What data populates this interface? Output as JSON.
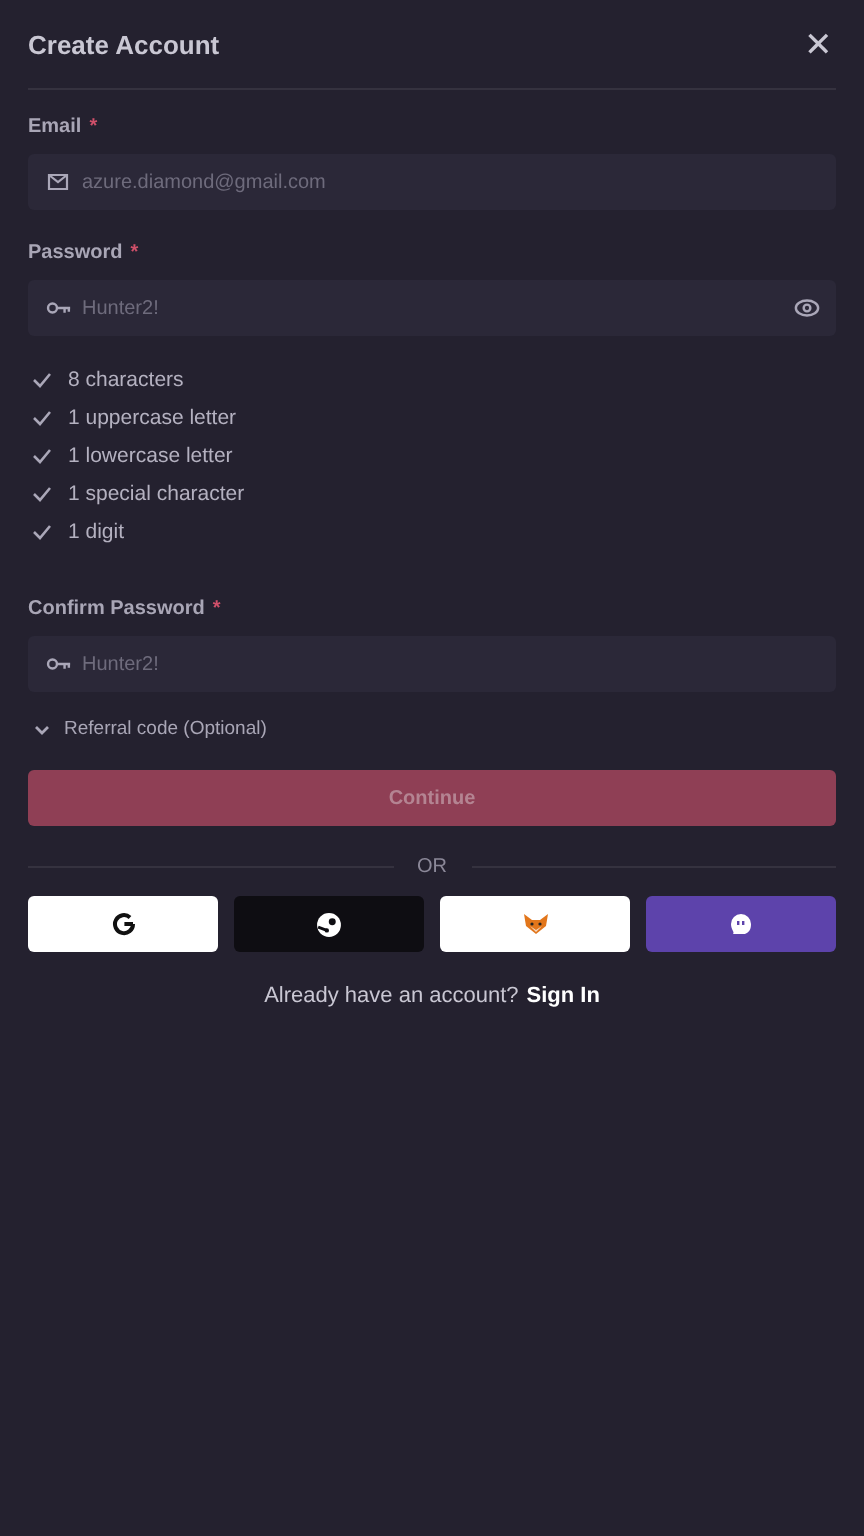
{
  "header": {
    "title": "Create Account",
    "close": "✕"
  },
  "email": {
    "label": "Email",
    "required": "*",
    "placeholder": "azure.diamond@gmail.com"
  },
  "password": {
    "label": "Password",
    "required": "*",
    "placeholder": "Hunter2!"
  },
  "requirements": [
    {
      "text": "8 characters",
      "met": true
    },
    {
      "text": "1 uppercase letter",
      "met": true
    },
    {
      "text": "1 lowercase letter",
      "met": true
    },
    {
      "text": "1 special character",
      "met": true
    },
    {
      "text": "1 digit",
      "met": true
    }
  ],
  "confirm": {
    "label": "Confirm Password",
    "required": "*",
    "placeholder": "Hunter2!"
  },
  "referral": {
    "label": "Referral code (Optional)",
    "expanded": false
  },
  "continue": {
    "label": "Continue",
    "disabled": true
  },
  "divider": "OR",
  "social": [
    {
      "kind": "google",
      "color": "#ffffff"
    },
    {
      "kind": "steam",
      "color": "#0e0d12"
    },
    {
      "kind": "metamask",
      "color": "#ffffff"
    },
    {
      "kind": "ghost",
      "color": "#5d43ab"
    }
  ],
  "footer": {
    "text": "Already have an account?",
    "link": "Sign In"
  }
}
